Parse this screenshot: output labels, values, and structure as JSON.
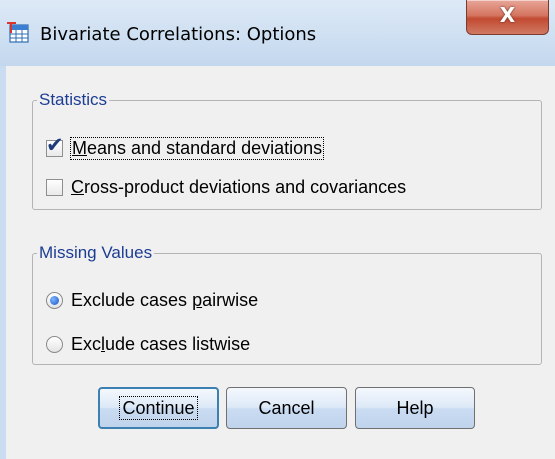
{
  "window": {
    "title": "Bivariate Correlations: Options",
    "close_glyph": "X",
    "app_icon": "spss-table-icon"
  },
  "statistics": {
    "legend": "Statistics",
    "means": {
      "pre": "",
      "key": "M",
      "post": "eans and standard deviations",
      "checked": true
    },
    "crossprod": {
      "pre": "",
      "key": "C",
      "post": "ross-product deviations and covariances",
      "checked": false
    }
  },
  "missing": {
    "legend": "Missing Values",
    "pairwise": {
      "pre": "Exclude cases ",
      "key": "p",
      "post": "airwise",
      "selected": true
    },
    "listwise": {
      "pre": "Exc",
      "key": "l",
      "post": "ude cases listwise",
      "selected": false
    }
  },
  "buttons": {
    "continue": "Continue",
    "cancel": "Cancel",
    "help": "Help"
  },
  "colors": {
    "legend_text": "#1c3d94",
    "default_button_border": "#3c7fb1",
    "close_button": "#c24a31"
  }
}
